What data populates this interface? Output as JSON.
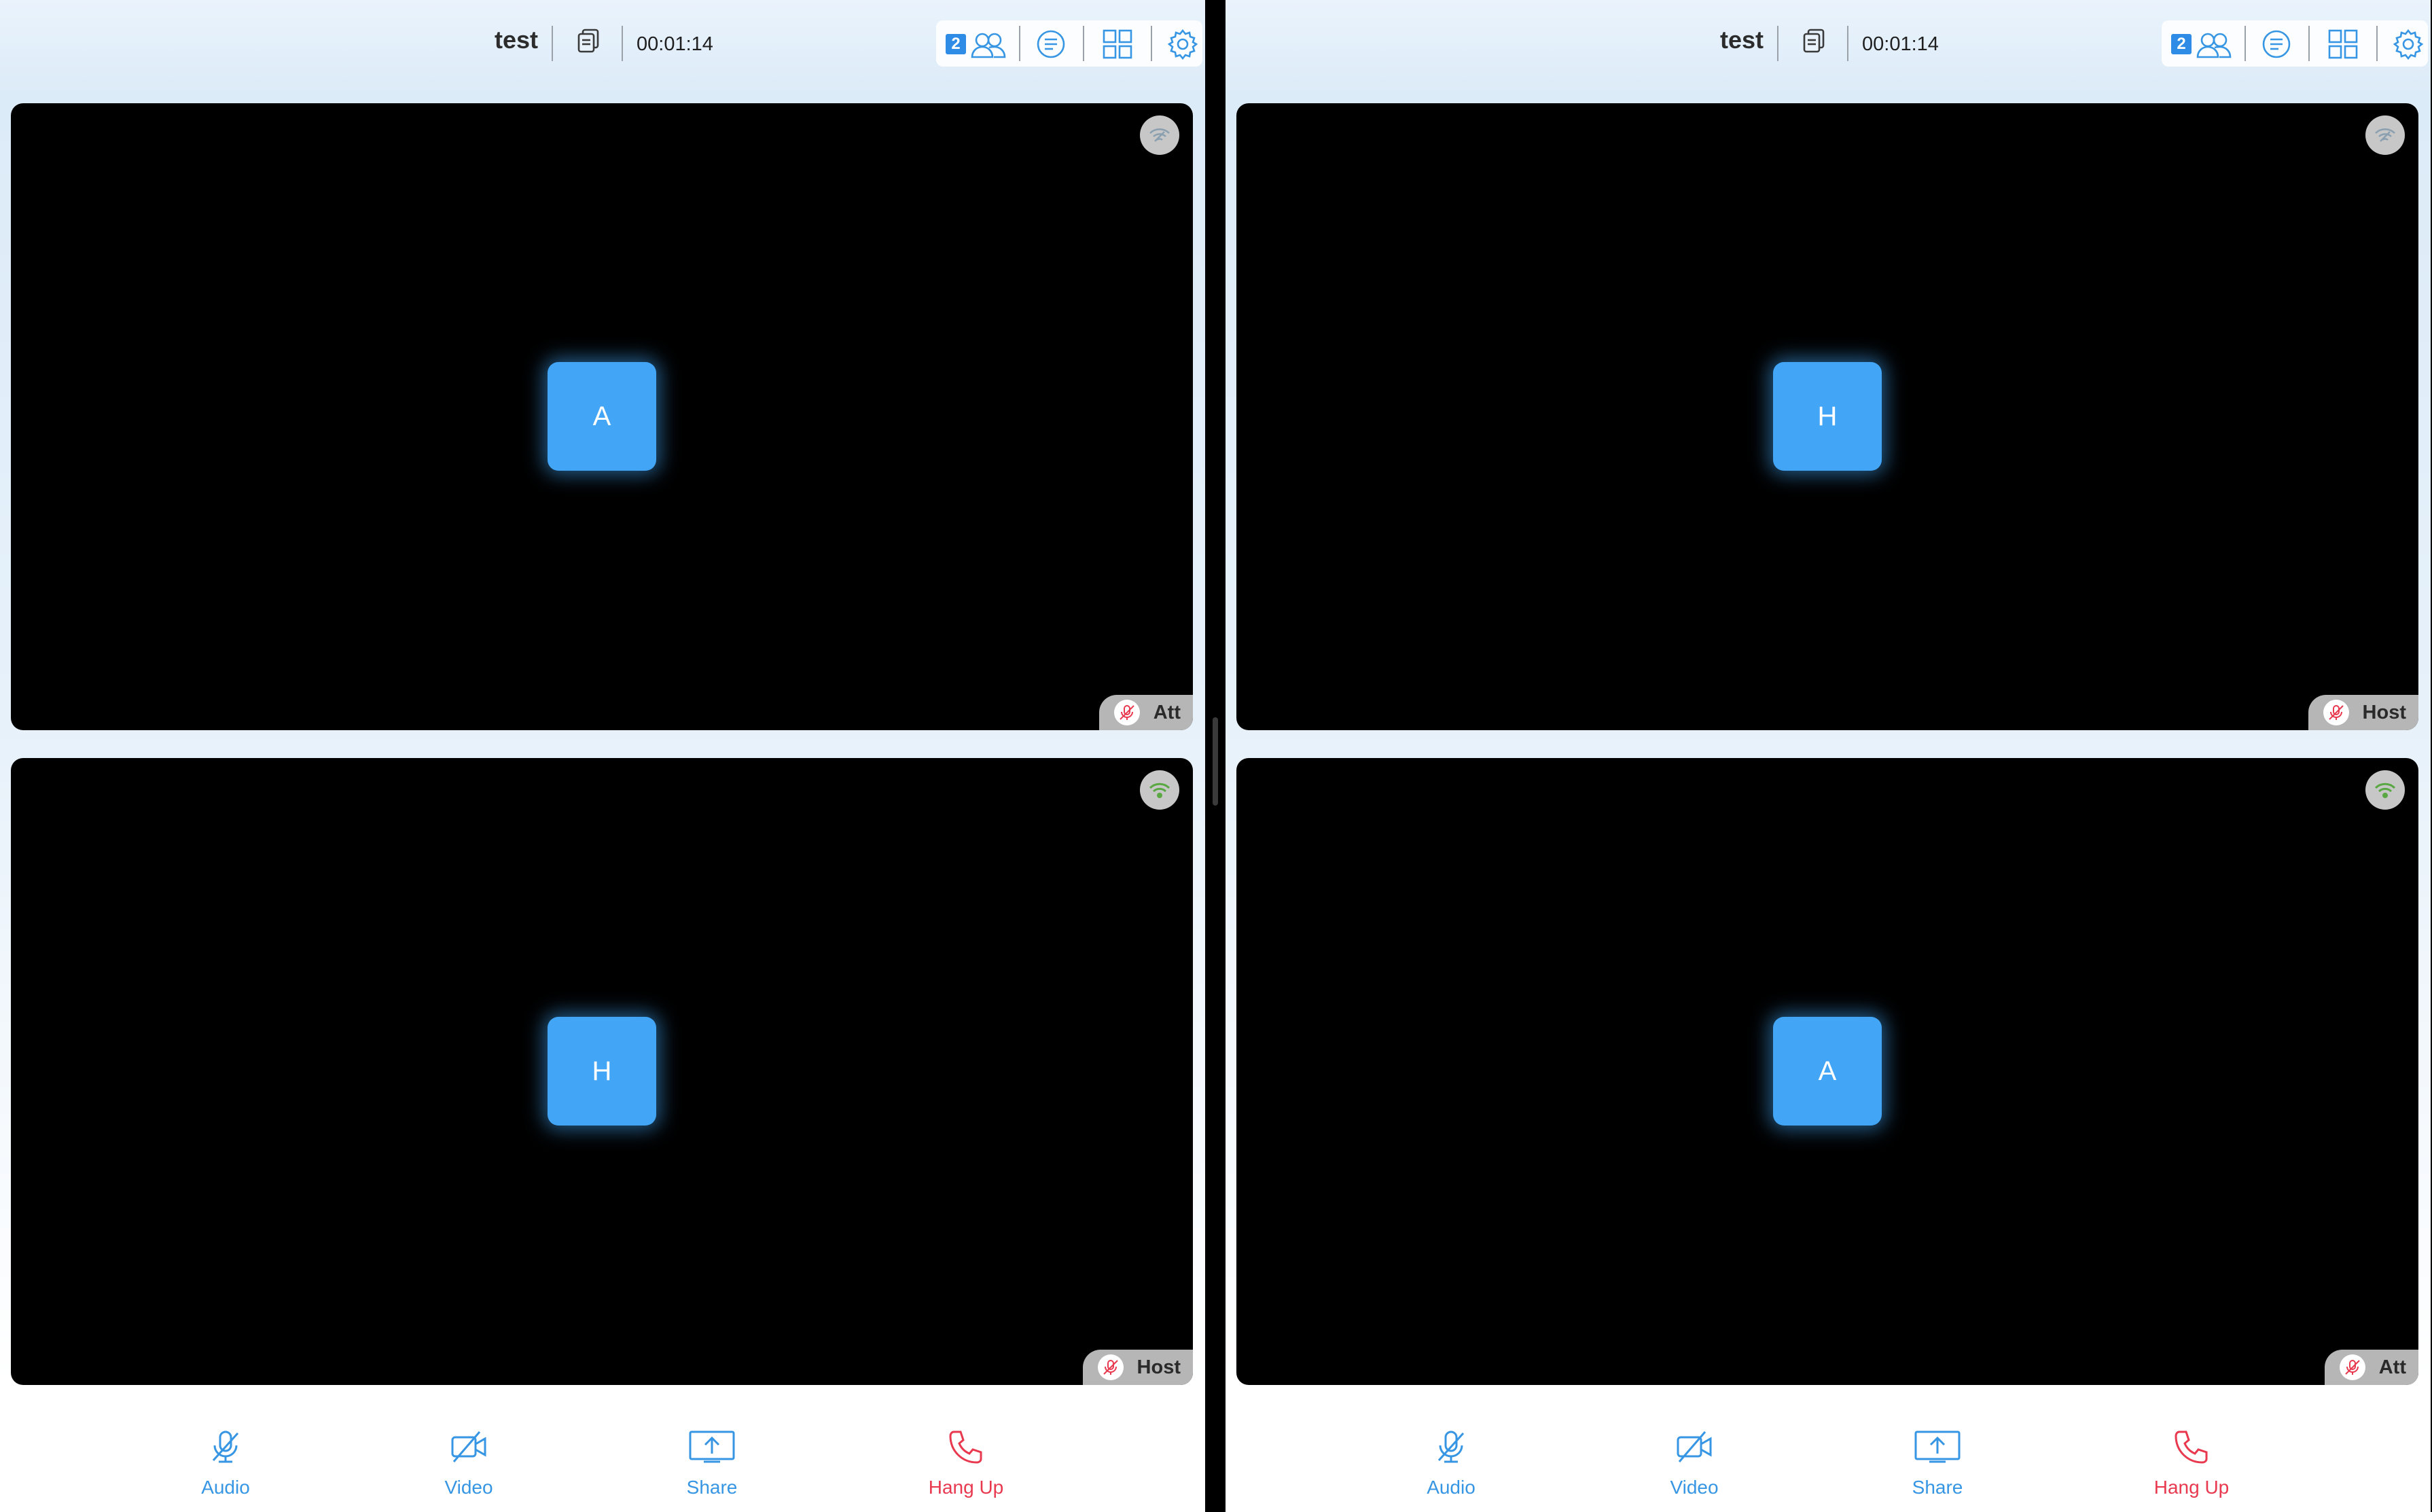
{
  "panes": [
    {
      "header": {
        "title": "test",
        "timer": "00:01:14",
        "participant_count": "2"
      },
      "tiles": [
        {
          "avatar": "A",
          "name": "Att",
          "network": "weak"
        },
        {
          "avatar": "H",
          "name": "Host",
          "network": "good"
        }
      ],
      "controls": {
        "audio": "Audio",
        "video": "Video",
        "share": "Share",
        "hangup": "Hang Up"
      }
    },
    {
      "header": {
        "title": "test",
        "timer": "00:01:14",
        "participant_count": "2"
      },
      "tiles": [
        {
          "avatar": "H",
          "name": "Host",
          "network": "weak"
        },
        {
          "avatar": "A",
          "name": "Att",
          "network": "good"
        }
      ],
      "controls": {
        "audio": "Audio",
        "video": "Video",
        "share": "Share",
        "hangup": "Hang Up"
      }
    }
  ],
  "colors": {
    "accent": "#3796e4",
    "avatar": "#42a5f5",
    "hangup": "#e8394f",
    "network_good": "#5aa844",
    "network_weak": "#8aa0b0"
  },
  "icons": {
    "copy": "copy-icon",
    "participants": "participants-icon",
    "chat": "chat-list-icon",
    "layout": "grid-layout-icon",
    "settings": "gear-icon",
    "network": "wifi-signal-icon",
    "mic_off": "mic-off-icon",
    "video_off": "video-off-icon",
    "share": "share-screen-icon",
    "hangup": "phone-icon"
  }
}
